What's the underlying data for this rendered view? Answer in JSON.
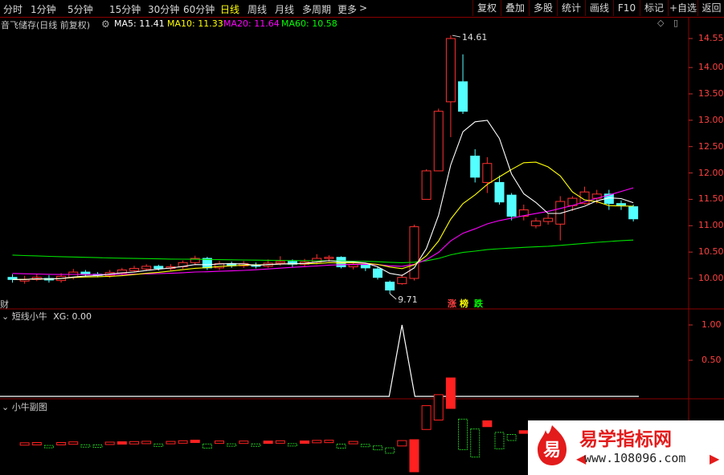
{
  "toolbar": {
    "periods": [
      "分时",
      "1分钟",
      "5分钟",
      "15分钟",
      "30分钟",
      "60分钟",
      "日线",
      "周线",
      "月线",
      "多周期",
      "更多"
    ],
    "active_period": "日线",
    "more_arrow": ">",
    "buttons": [
      "复权",
      "叠加",
      "多股",
      "统计",
      "画线",
      "F10",
      "标记",
      "+自选",
      "返回"
    ]
  },
  "info": {
    "stock": "音飞储存(日线 前复权)",
    "ma5": "MA5: 11.41",
    "ma10": "MA10: 11.33",
    "ma20": "MA20: 11.64",
    "ma60": "MA60: 10.58",
    "colors": {
      "ma5": "#ffffff",
      "ma10": "#ffff00",
      "ma20": "#ff00ff",
      "ma60": "#00ff00"
    }
  },
  "main_chart": {
    "y_ticks": [
      "14.55",
      "14.00",
      "13.50",
      "13.00",
      "12.50",
      "12.00",
      "11.50",
      "11.00",
      "10.50",
      "10.00"
    ],
    "high_label": "14.61",
    "low_label": "9.71",
    "left_tag": "财",
    "badges": [
      "涨",
      "榜",
      "跌"
    ],
    "candles": [
      [
        10.02,
        9.98,
        10.08,
        9.92
      ],
      [
        9.95,
        9.98,
        10.05,
        9.9
      ],
      [
        9.98,
        10.02,
        10.08,
        9.95
      ],
      [
        10.0,
        9.97,
        10.06,
        9.92
      ],
      [
        9.96,
        10.04,
        10.1,
        9.92
      ],
      [
        10.02,
        10.12,
        10.18,
        9.98
      ],
      [
        10.12,
        10.08,
        10.16,
        10.03
      ],
      [
        10.08,
        10.06,
        10.12,
        10.02
      ],
      [
        10.05,
        10.11,
        10.16,
        10.01
      ],
      [
        10.1,
        10.16,
        10.2,
        10.06
      ],
      [
        10.15,
        10.19,
        10.24,
        10.12
      ],
      [
        10.18,
        10.23,
        10.27,
        10.14
      ],
      [
        10.23,
        10.19,
        10.26,
        10.15
      ],
      [
        10.19,
        10.22,
        10.27,
        10.15
      ],
      [
        10.22,
        10.3,
        10.34,
        10.18
      ],
      [
        10.3,
        10.38,
        10.43,
        10.25
      ],
      [
        10.38,
        10.2,
        10.41,
        10.16
      ],
      [
        10.2,
        10.28,
        10.33,
        10.16
      ],
      [
        10.28,
        10.24,
        10.32,
        10.2
      ],
      [
        10.24,
        10.28,
        10.33,
        10.2
      ],
      [
        10.26,
        10.23,
        10.3,
        10.19
      ],
      [
        10.23,
        10.29,
        10.36,
        10.2
      ],
      [
        10.29,
        10.32,
        10.42,
        10.24
      ],
      [
        10.32,
        10.27,
        10.36,
        10.22
      ],
      [
        10.27,
        10.31,
        10.37,
        10.23
      ],
      [
        10.31,
        10.38,
        10.46,
        10.27
      ],
      [
        10.38,
        10.4,
        10.44,
        10.32
      ],
      [
        10.4,
        10.22,
        10.42,
        10.19
      ],
      [
        10.22,
        10.26,
        10.3,
        10.17
      ],
      [
        10.25,
        10.2,
        10.3,
        10.14
      ],
      [
        10.18,
        10.02,
        10.22,
        9.98
      ],
      [
        9.93,
        9.78,
        9.96,
        9.71
      ],
      [
        9.9,
        10.02,
        10.08,
        9.88
      ],
      [
        10.0,
        10.98,
        11.02,
        9.96
      ],
      [
        11.5,
        12.04,
        12.07,
        11.5
      ],
      [
        12.04,
        13.17,
        13.22,
        12.04
      ],
      [
        13.35,
        14.55,
        14.61,
        12.68
      ],
      [
        13.73,
        13.17,
        14.25,
        13.12
      ],
      [
        12.32,
        11.92,
        12.45,
        11.82
      ],
      [
        11.82,
        12.18,
        12.3,
        11.62
      ],
      [
        11.82,
        11.45,
        11.95,
        11.4
      ],
      [
        11.58,
        11.18,
        11.62,
        11.1
      ],
      [
        11.18,
        11.3,
        11.4,
        11.1
      ],
      [
        11.0,
        11.09,
        11.15,
        10.95
      ],
      [
        11.08,
        11.14,
        11.22,
        11.02
      ],
      [
        11.03,
        11.46,
        11.56,
        10.72
      ],
      [
        11.38,
        11.52,
        11.56,
        11.28
      ],
      [
        11.42,
        11.64,
        11.74,
        11.4
      ],
      [
        11.52,
        11.6,
        11.68,
        11.42
      ],
      [
        11.6,
        11.42,
        11.68,
        11.3
      ],
      [
        11.42,
        11.39,
        11.48,
        11.3
      ],
      [
        11.36,
        11.13,
        11.4,
        11.08
      ]
    ]
  },
  "indicator1": {
    "name": "短线小牛",
    "xg": "XG: 0.00",
    "y_ticks": [
      "1.00",
      "0.50"
    ],
    "signal_index": 32
  },
  "indicator2": {
    "name": "小牛副图"
  },
  "watermark": {
    "logo_char": "易",
    "title": "易学指标网",
    "url": "www.108096.com"
  }
}
